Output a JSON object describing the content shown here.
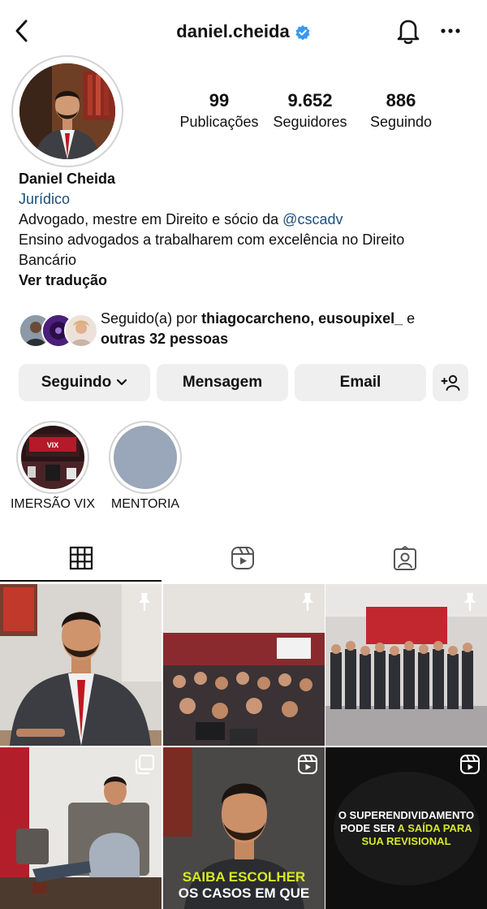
{
  "header": {
    "username": "daniel.cheida"
  },
  "stats": [
    {
      "value": "99",
      "label": "Publicações"
    },
    {
      "value": "9.652",
      "label": "Seguidores"
    },
    {
      "value": "886",
      "label": "Seguindo"
    }
  ],
  "bio": {
    "name": "Daniel Cheida",
    "category": "Jurídico",
    "line1_prefix": "Advogado, mestre em Direito e sócio da ",
    "line1_mention": "@cscadv",
    "line2": "Ensino advogados a trabalharem com excelência no Direito",
    "line3": "Bancário",
    "translate": "Ver tradução"
  },
  "followed_by": {
    "prefix": "Seguido(a) por ",
    "names": "thiagocarcheno, eusoupixel_",
    "conjunction": " e",
    "others": "outras 32 pessoas"
  },
  "buttons": {
    "following": "Seguindo",
    "message": "Mensagem",
    "email": "Email"
  },
  "highlights": [
    {
      "label": "IMERSÃO VIX"
    },
    {
      "label": "MENTORIA"
    }
  ],
  "tabs": [
    "grid-icon",
    "reels-icon",
    "tagged-icon"
  ],
  "posts": [
    {
      "type": "pinned"
    },
    {
      "type": "pinned"
    },
    {
      "type": "pinned"
    },
    {
      "type": "carousel"
    },
    {
      "type": "reel",
      "caption_1": "SAIBA ESCOLHER",
      "caption_2": "OS CASOS EM QUE"
    },
    {
      "type": "reel",
      "caption_1": "O SUPERENDIVIDAMENTO",
      "caption_2": "PODE SER ",
      "caption_highlight": "A SAÍDA PARA",
      "caption_3": "SUA REVISIONAL"
    }
  ],
  "colors": {
    "verified": "#3897f0",
    "link": "#1f4f7d",
    "button_bg": "#efefef",
    "highlight_yellow": "#d7e829"
  }
}
